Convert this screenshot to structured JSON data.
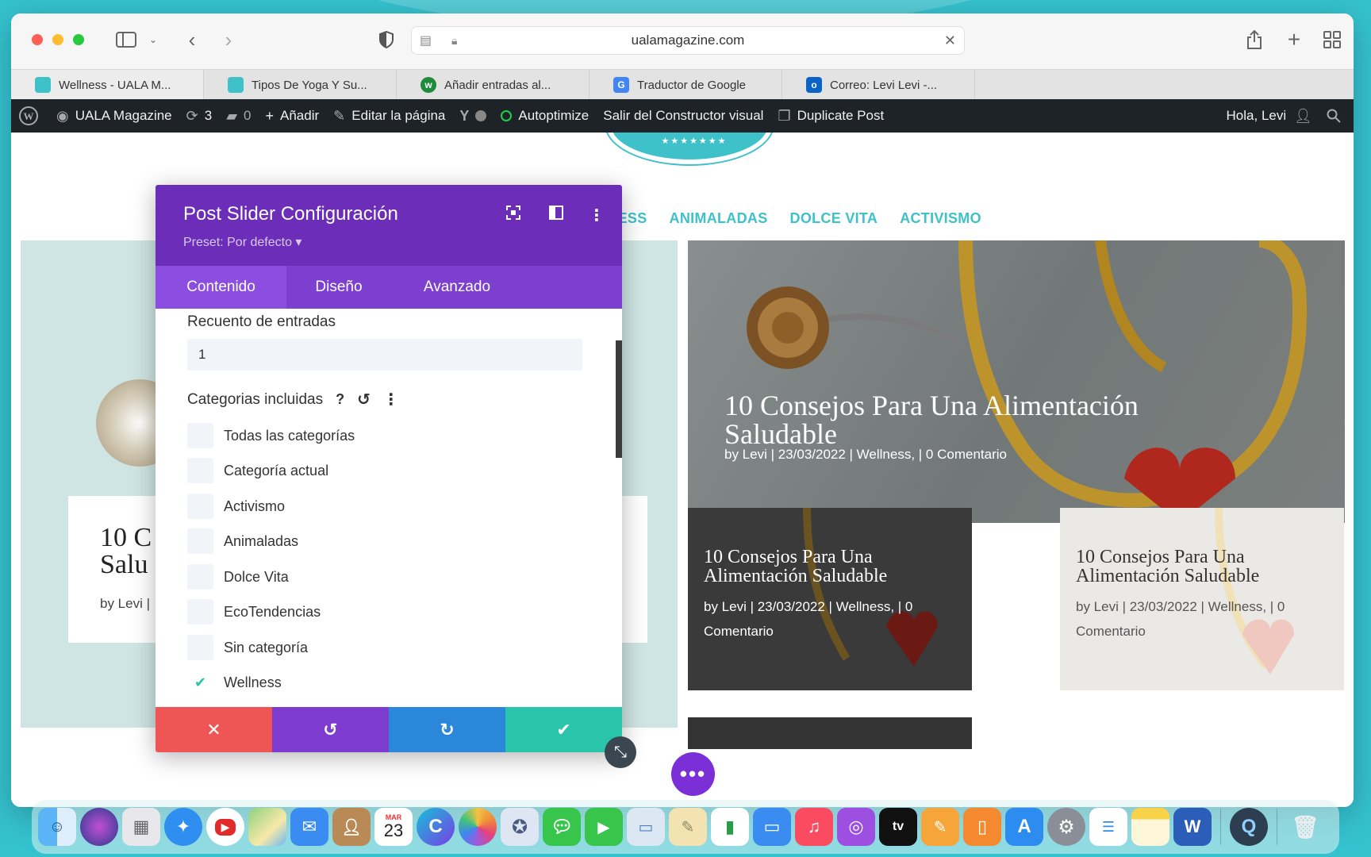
{
  "browser": {
    "url": "ualamagazine.com",
    "tabs": [
      {
        "label": "Wellness - UALA M...",
        "color": "#3ec1c9"
      },
      {
        "label": "Tipos De Yoga Y Su...",
        "color": "#3ec1c9"
      },
      {
        "label": "Añadir entradas al...",
        "color": "#1e8a3c"
      },
      {
        "label": "Traductor de Google",
        "color": "#4285f4"
      },
      {
        "label": "Correo: Levi Levi -...",
        "color": "#0a64c8"
      }
    ]
  },
  "adminbar": {
    "site_name": "UALA Magazine",
    "updates_count": "3",
    "comments_count": "0",
    "add_label": "Añadir",
    "edit_label": "Editar la página",
    "autoptimize_label": "Autoptimize",
    "exit_builder_label": "Salir del Constructor visual",
    "duplicate_label": "Duplicate Post",
    "greeting": "Hola, Levi"
  },
  "site_nav": {
    "items": [
      "LNESS",
      "ANIMALADAS",
      "DOLCE VITA",
      "ACTIVISMO"
    ]
  },
  "posts": {
    "left_title_partial": "10 C",
    "left_title_partial_2": "Salu",
    "left_meta_partial": "by Levi  |",
    "big": {
      "title": "10 Consejos Para Una Alimentación Saludable",
      "meta": "by Levi | 23/03/2022 | Wellness, | 0 Comentario"
    },
    "small_dark": {
      "title": "10 Consejos Para Una Alimentación Saludable",
      "meta": "by Levi | 23/03/2022 | Wellness, | 0 Comentario"
    },
    "small_light": {
      "title": "10 Consejos Para Una Alimentación Saludable",
      "meta": "by Levi | 23/03/2022 | Wellness, | 0 Comentario"
    }
  },
  "panel": {
    "title": "Post Slider Configuración",
    "preset": "Preset: Por defecto ▾",
    "tabs": [
      "Contenido",
      "Diseño",
      "Avanzado"
    ],
    "post_count_label": "Recuento de entradas",
    "post_count_value": "1",
    "categories_label": "Categorias incluidas",
    "categories": [
      {
        "label": "Todas las categorías",
        "checked": false
      },
      {
        "label": "Categoría actual",
        "checked": false
      },
      {
        "label": "Activismo",
        "checked": false
      },
      {
        "label": "Animaladas",
        "checked": false
      },
      {
        "label": "Dolce Vita",
        "checked": false
      },
      {
        "label": "EcoTendencias",
        "checked": false
      },
      {
        "label": "Sin categoría",
        "checked": false
      },
      {
        "label": "Wellness",
        "checked": true
      }
    ],
    "footer_colors": {
      "cancel": "#ef5555",
      "undo": "#7e3bd0",
      "redo": "#2b87da",
      "save": "#29c4a9"
    }
  },
  "dock": {
    "calendar_month": "MAR",
    "calendar_day": "23",
    "tv_label": "tv"
  }
}
